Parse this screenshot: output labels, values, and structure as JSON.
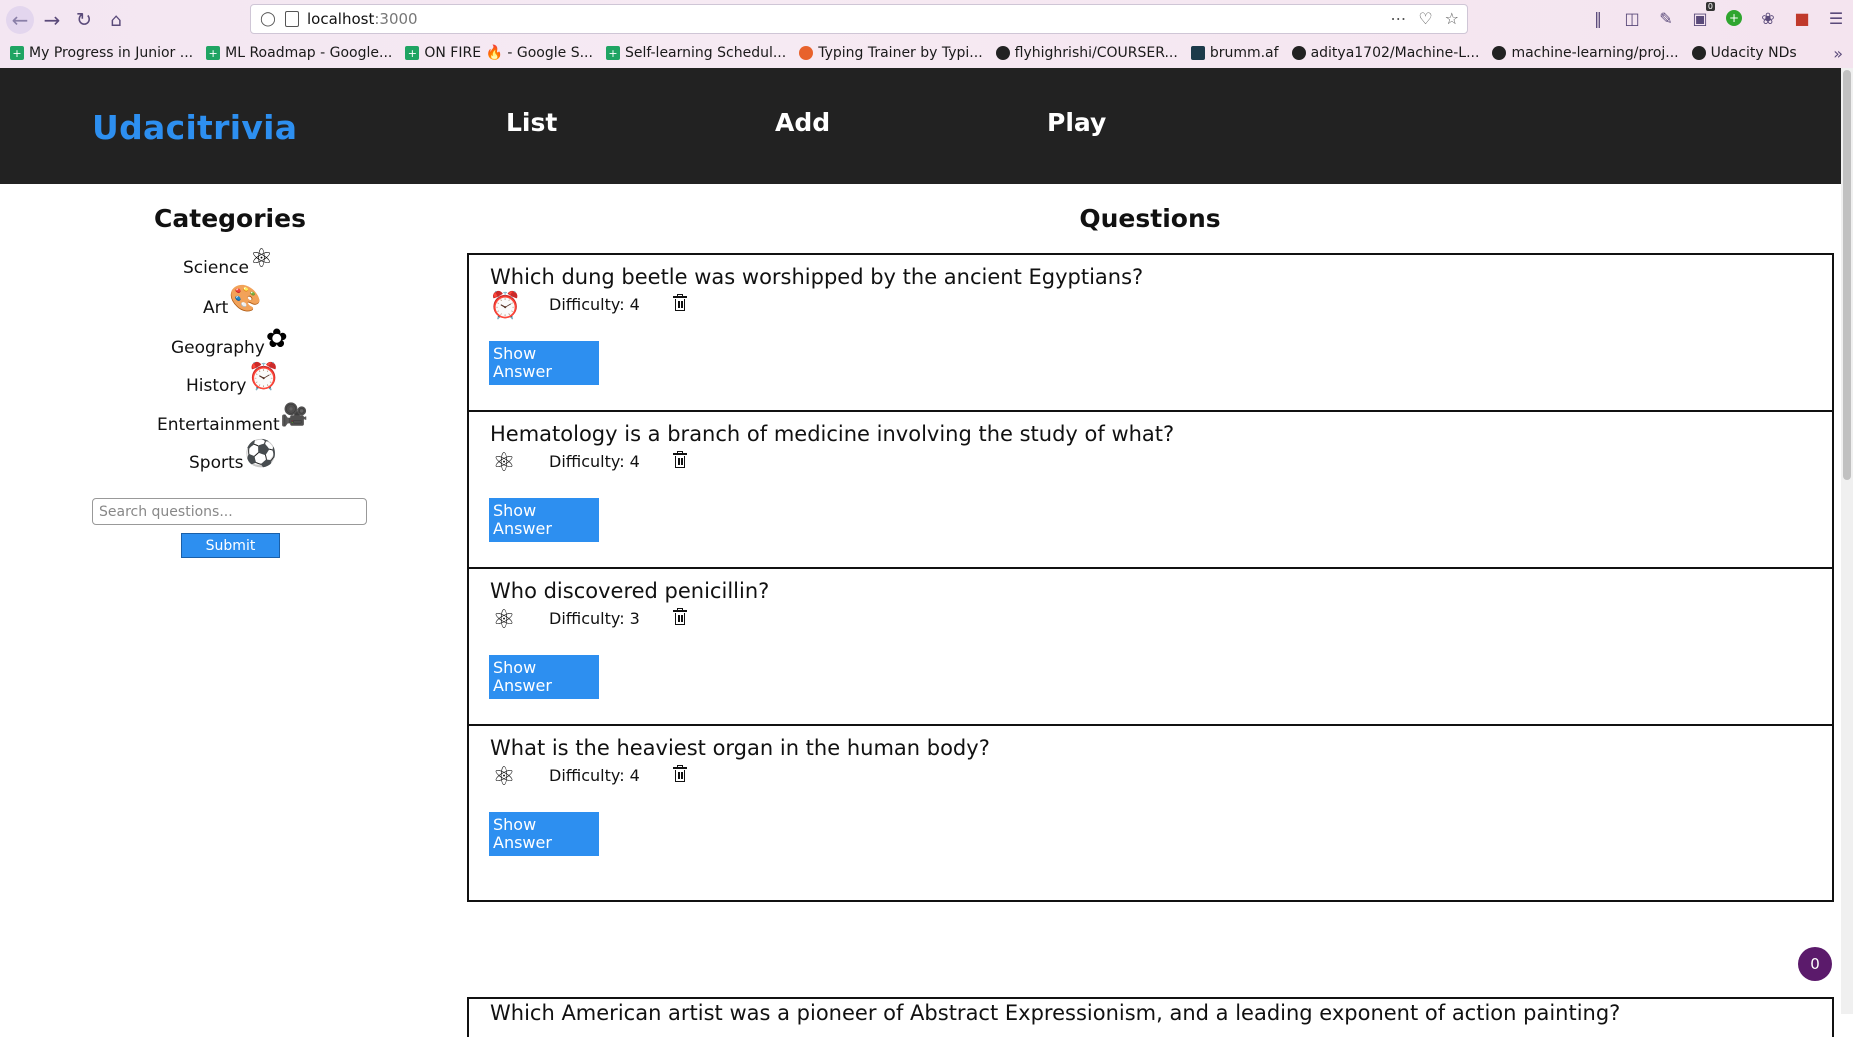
{
  "browser": {
    "url_host": "localhost",
    "url_port": ":3000",
    "bookmarks": [
      {
        "label": "My Progress in Junior ...",
        "icon": "sheet-icon"
      },
      {
        "label": "ML Roadmap - Google...",
        "icon": "sheet-icon"
      },
      {
        "label": "ON FIRE 🔥 - Google S...",
        "icon": "sheet-icon"
      },
      {
        "label": "Self-learning Schedul...",
        "icon": "sheet-icon"
      },
      {
        "label": "Typing Trainer by Typi...",
        "icon": "typing-icon"
      },
      {
        "label": "flyhighrishi/COURSER...",
        "icon": "github-icon"
      },
      {
        "label": "brumm.af",
        "icon": "brumm-icon"
      },
      {
        "label": "aditya1702/Machine-L...",
        "icon": "github-icon"
      },
      {
        "label": "machine-learning/proj...",
        "icon": "github-icon"
      },
      {
        "label": "Udacity NDs",
        "icon": "github-icon"
      }
    ],
    "extension_badge": "0"
  },
  "header": {
    "logo": "Udacitrivia",
    "nav": {
      "list": "List",
      "add": "Add",
      "play": "Play"
    }
  },
  "categories": {
    "title": "Categories",
    "items": [
      {
        "label": "Science",
        "icon": "science-atom-icon"
      },
      {
        "label": "Art",
        "icon": "art-palette-icon"
      },
      {
        "label": "Geography",
        "icon": "geography-africa-icon"
      },
      {
        "label": "History",
        "icon": "history-clock-icon"
      },
      {
        "label": "Entertainment",
        "icon": "entertainment-camera-icon"
      },
      {
        "label": "Sports",
        "icon": "sports-ball-icon"
      }
    ]
  },
  "search": {
    "placeholder": "Search questions...",
    "submit_label": "Submit"
  },
  "questions": {
    "title": "Questions",
    "items": [
      {
        "text": "Which dung beetle was worshipped by the ancient Egyptians?",
        "difficulty": "Difficulty: 4",
        "category_icon": "history-clock-icon",
        "show_answer": "Show Answer"
      },
      {
        "text": "Hematology is a branch of medicine involving the study of what?",
        "difficulty": "Difficulty: 4",
        "category_icon": "science-atom-icon",
        "show_answer": "Show Answer"
      },
      {
        "text": "Who discovered penicillin?",
        "difficulty": "Difficulty: 3",
        "category_icon": "science-atom-icon",
        "show_answer": "Show Answer"
      },
      {
        "text": "What is the heaviest organ in the human body?",
        "difficulty": "Difficulty: 4",
        "category_icon": "science-atom-icon",
        "show_answer": "Show Answer"
      }
    ],
    "partial": "Which American artist was a pioneer of Abstract Expressionism, and a leading exponent of action painting?"
  },
  "notification_badge": "0",
  "colors": {
    "accent": "#2d8ff0",
    "header_bg": "#222222",
    "badge_bg": "#5b1a6b"
  }
}
